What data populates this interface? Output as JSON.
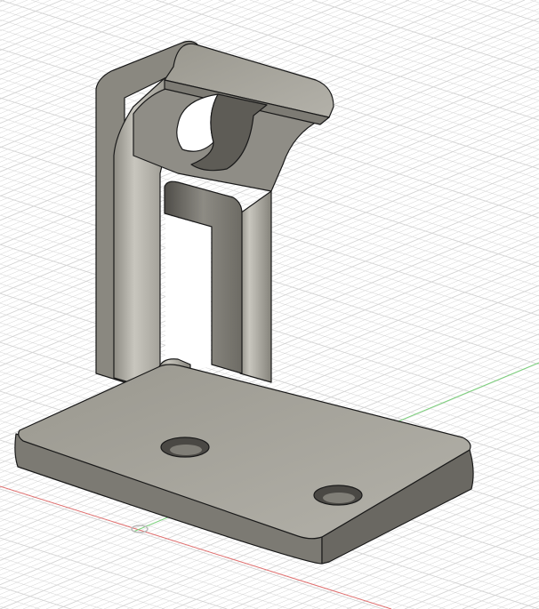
{
  "viewport": {
    "type": "cad-3d-viewport",
    "model": "bracket",
    "colors": {
      "background": "#ffffff",
      "grid": "#d4d4d4",
      "x_axis": "#e07070",
      "y_axis": "#7ad07a",
      "body_light": "#a9a79f",
      "body_mid": "#8c8a82",
      "body_dark": "#5f5d57",
      "edge": "#1a1a1a"
    }
  }
}
